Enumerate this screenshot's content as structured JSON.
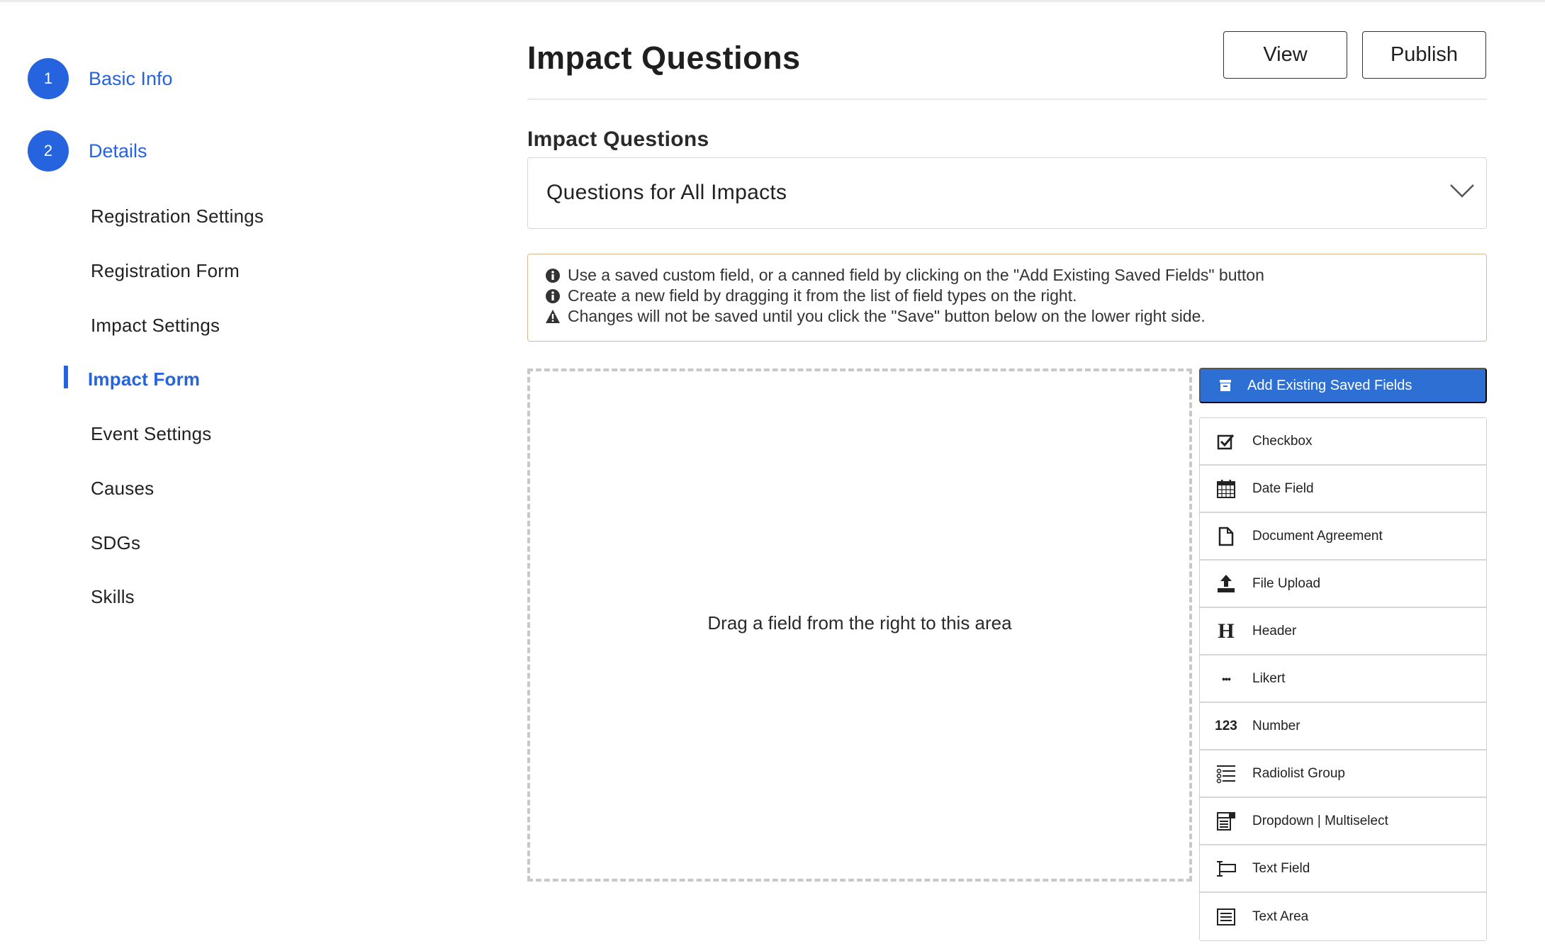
{
  "steps": [
    {
      "number": "1",
      "label": "Basic Info"
    },
    {
      "number": "2",
      "label": "Details"
    }
  ],
  "nav": {
    "items": [
      {
        "label": "Registration Settings"
      },
      {
        "label": "Registration Form"
      },
      {
        "label": "Impact Settings"
      },
      {
        "label": "Impact Form"
      },
      {
        "label": "Event Settings"
      },
      {
        "label": "Causes"
      },
      {
        "label": "SDGs"
      },
      {
        "label": "Skills"
      }
    ],
    "active": "Impact Form"
  },
  "header": {
    "title": "Impact Questions",
    "view_label": "View",
    "publish_label": "Publish"
  },
  "impact_questions": {
    "label": "Impact Questions",
    "selected": "Questions for All Impacts"
  },
  "notice": {
    "lines": [
      {
        "icon": "info-icon",
        "text": "Use a saved custom field, or a canned field by clicking on the \"Add Existing Saved Fields\" button"
      },
      {
        "icon": "info-icon",
        "text": "Create a new field by dragging it from the list of field types on the right."
      },
      {
        "icon": "warning-icon",
        "text": "Changes will not be saved until you click the \"Save\" button below on the lower right side."
      }
    ],
    "border_color": "#d9b98a"
  },
  "dropzone": {
    "text": "Drag a field from the right to this area"
  },
  "toolbox": {
    "add_existing_label": "Add Existing Saved Fields",
    "fields": [
      {
        "icon": "checkbox-icon",
        "label": "Checkbox"
      },
      {
        "icon": "calendar-icon",
        "label": "Date Field"
      },
      {
        "icon": "document-icon",
        "label": "Document Agreement"
      },
      {
        "icon": "upload-icon",
        "label": "File Upload"
      },
      {
        "icon": "header-icon",
        "label": "Header",
        "glyph": "H"
      },
      {
        "icon": "ellipsis-icon",
        "label": "Likert",
        "glyph": "•••"
      },
      {
        "icon": "number-icon",
        "label": "Number",
        "glyph": "123"
      },
      {
        "icon": "radiolist-icon",
        "label": "Radiolist Group"
      },
      {
        "icon": "dropdown-icon",
        "label": "Dropdown | Multiselect"
      },
      {
        "icon": "text-field-icon",
        "label": "Text Field"
      },
      {
        "icon": "text-area-icon",
        "label": "Text Area"
      }
    ]
  },
  "colors": {
    "accent": "#2563df",
    "button_blue": "#2e6fd4"
  }
}
